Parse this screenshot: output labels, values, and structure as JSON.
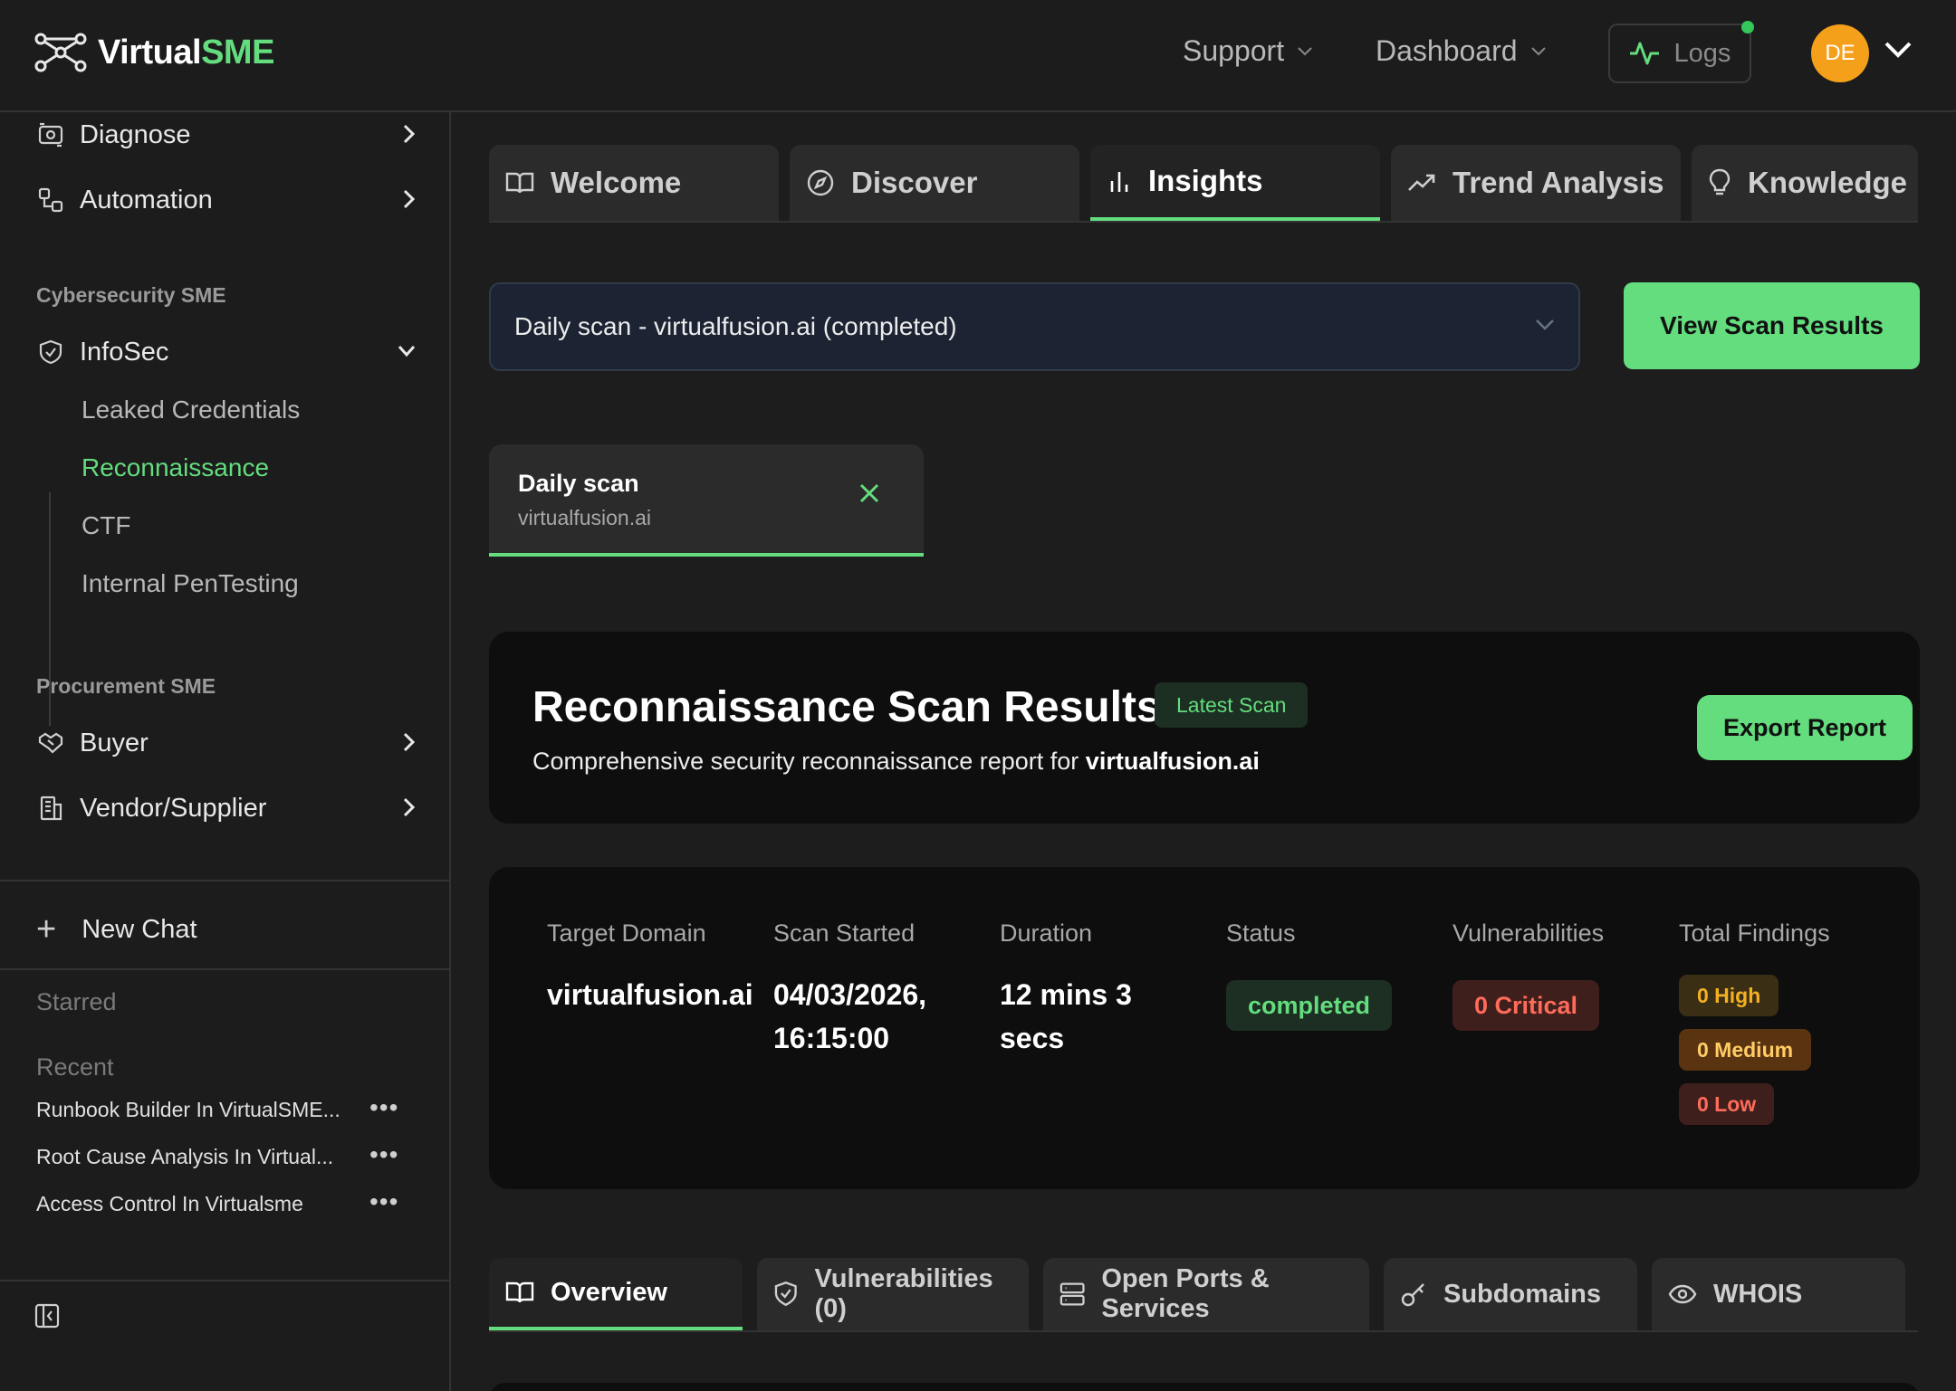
{
  "brand": {
    "name_prefix": "Virtual",
    "name_suffix": "SME",
    "accent": "#63dd7e"
  },
  "header": {
    "support": "Support",
    "dashboard": "Dashboard",
    "logs": "Logs",
    "avatar_initials": "DE"
  },
  "sidebar": {
    "items_top": [
      {
        "label": "Diagnose",
        "icon": "diagnose-icon"
      },
      {
        "label": "Automation",
        "icon": "automation-icon"
      }
    ],
    "section_cyber": "Cybersecurity SME",
    "infosec": "InfoSec",
    "infosec_sub": [
      "Leaked Credentials",
      "Reconnaissance",
      "CTF",
      "Internal PenTesting"
    ],
    "section_procurement": "Procurement SME",
    "buyer": "Buyer",
    "vendor": "Vendor/Supplier",
    "new_chat": "New Chat",
    "starred": "Starred",
    "recent": "Recent",
    "recent_items": [
      "Runbook Builder In VirtualSME...",
      "Root Cause Analysis In Virtual...",
      "Access Control In Virtualsme"
    ]
  },
  "tabs": [
    "Welcome",
    "Discover",
    "Insights",
    "Trend Analysis",
    "Knowledge"
  ],
  "scan_select": {
    "value": "Daily scan - virtualfusion.ai (completed)"
  },
  "view_button": "View Scan Results",
  "scan_card": {
    "title": "Daily scan",
    "subtitle": "virtualfusion.ai"
  },
  "results": {
    "title": "Reconnaissance Scan Results",
    "badge": "Latest Scan",
    "subtitle_prefix": "Comprehensive security reconnaissance report for ",
    "subtitle_domain": "virtualfusion.ai",
    "export": "Export Report"
  },
  "meta": {
    "target_label": "Target Domain",
    "target_value": "virtualfusion.ai",
    "started_label": "Scan Started",
    "started_line1": "04/03/2026,",
    "started_line2": "16:15:00",
    "duration_label": "Duration",
    "duration_line1": "12 mins 3",
    "duration_line2": "secs",
    "status_label": "Status",
    "status_value": "completed",
    "vuln_label": "Vulnerabilities",
    "vuln_value": "0 Critical",
    "findings_label": "Total Findings",
    "findings": [
      "0 High",
      "0 Medium",
      "0 Low"
    ]
  },
  "sub_tabs": [
    "Overview",
    "Vulnerabilities (0)",
    "Open Ports & Services",
    "Subdomains",
    "WHOIS"
  ]
}
